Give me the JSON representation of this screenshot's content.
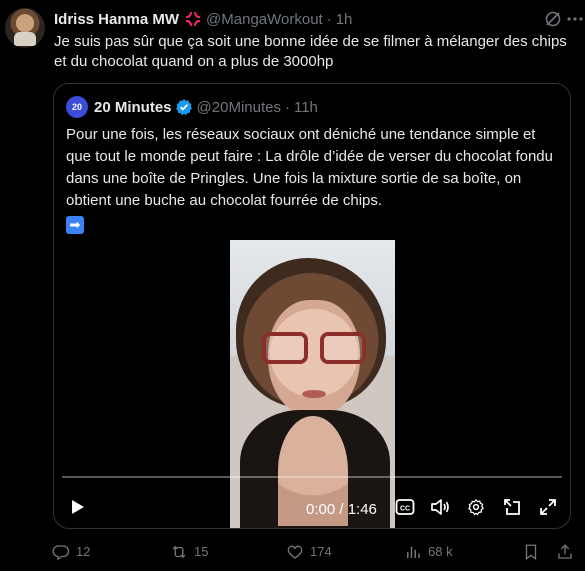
{
  "tweet": {
    "author_name": "Idriss Hanma MW",
    "badge_icon": "anger-symbol-emoji",
    "handle": "@MangaWorkout",
    "separator": "·",
    "time": "1h",
    "text": "Je suis pas sûr que ça soit une bonne idée de se filmer à mélanger des chips et du chocolat quand on a plus de 3000hp"
  },
  "quote": {
    "avatar_text": "20",
    "author_name": "20 Minutes",
    "handle": "@20Minutes",
    "separator": "·",
    "time": "11h",
    "text": "Pour une fois, les réseaux sociaux ont déniché une tendance simple et que tout le monde peut faire : La drôle d’idée de verser du chocolat fondu dans une boîte de Pringles. Une fois la mixture sortie de sa boîte, on obtient une buche au chocolat fourrée de chips.",
    "trailing_emoji": "➡"
  },
  "video": {
    "time_readout": "0:00 / 1:46",
    "progress_fraction": 0.0
  },
  "actions": {
    "replies": "12",
    "reposts": "15",
    "likes": "174",
    "views": "68 k"
  },
  "colors": {
    "background": "#000000",
    "text": "#e7e9ea",
    "muted": "#71767b",
    "border": "#2f3336",
    "verified": "#1d9bf0"
  }
}
